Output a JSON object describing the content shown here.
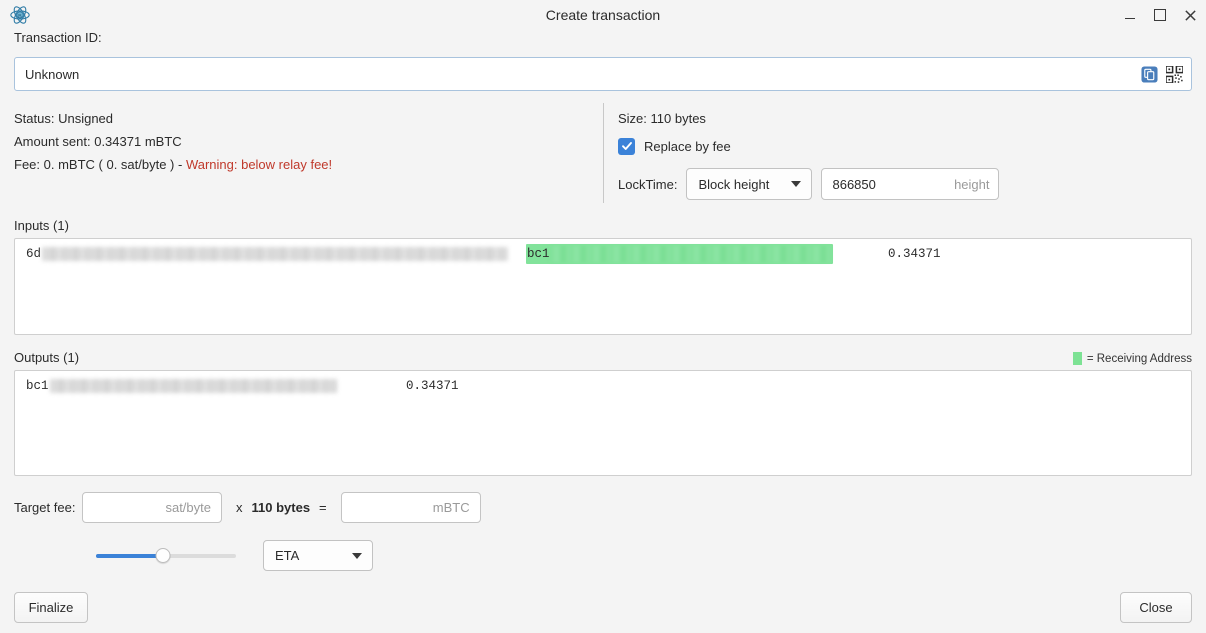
{
  "window": {
    "title": "Create transaction",
    "app_icon": "sparrow-atom-icon",
    "controls": {
      "minimize": "minimize-icon",
      "maximize": "maximize-icon",
      "close": "close-icon"
    }
  },
  "txid": {
    "label": "Transaction ID:",
    "value": "Unknown",
    "copy_icon": "copy-icon",
    "qr_icon": "qr-code-icon"
  },
  "summary": {
    "status": "Status: Unsigned",
    "amount_sent": "Amount sent: 0.34371 mBTC",
    "fee_prefix": "Fee: 0. mBTC ( 0. sat/byte ) - ",
    "fee_warning": "Warning: below relay fee!",
    "warning_color": "#c0392b"
  },
  "settings": {
    "size": "Size: 110 bytes",
    "replace_by_fee_label": "Replace by fee",
    "replace_by_fee_checked": true,
    "checkbox_color": "#3b82d8",
    "locktime_label": "LockTime:",
    "locktime_mode": "Block height",
    "locktime_value": "866850",
    "locktime_placeholder": "height"
  },
  "inputs": {
    "title": "Inputs (1)",
    "rows": [
      {
        "txid_prefix": "6d",
        "address_prefix": "bc1",
        "amount": "0.34371",
        "receiving": true
      }
    ]
  },
  "outputs": {
    "title": "Outputs (1)",
    "legend": "= Receiving Address",
    "legend_color": "#7de294",
    "rows": [
      {
        "address_prefix": "bc1",
        "amount": "0.34371",
        "receiving": false
      }
    ]
  },
  "fee": {
    "label": "Target fee:",
    "rate_value": "",
    "rate_placeholder": "sat/byte",
    "multiply_symbol": "x",
    "size_bytes": "110 bytes",
    "equals_symbol": "=",
    "total_value": "",
    "total_placeholder": "mBTC",
    "slider_percent": 48,
    "slider_color": "#3b82d8",
    "mode": "ETA"
  },
  "footer": {
    "finalize_label": "Finalize",
    "close_label": "Close"
  }
}
